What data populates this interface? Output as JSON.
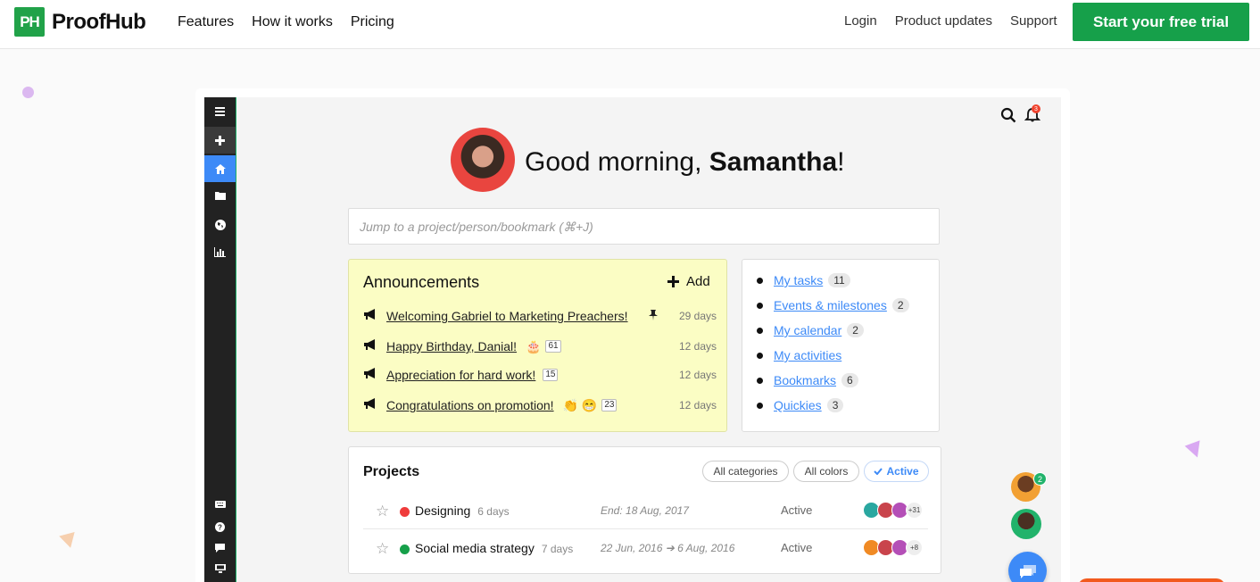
{
  "nav": {
    "logo_mark": "PH",
    "logo_text": "ProofHub",
    "links": [
      "Features",
      "How it works",
      "Pricing"
    ],
    "right_links": [
      "Login",
      "Product updates",
      "Support"
    ],
    "cta": "Start your free trial"
  },
  "app": {
    "notifications_count": "3",
    "greeting_prefix": "Good morning, ",
    "user_name": "Samantha",
    "greeting_suffix": "!",
    "search_placeholder": "Jump to a project/person/bookmark (⌘+J)",
    "announcements": {
      "title": "Announcements",
      "add_label": "Add",
      "items": [
        {
          "text": "Welcoming Gabriel to Marketing Preachers!",
          "days": "29 days",
          "pinned": true,
          "emoji": "",
          "count": ""
        },
        {
          "text": "Happy Birthday, Danial!",
          "days": "12 days",
          "pinned": false,
          "emoji": "🎂",
          "count": "61"
        },
        {
          "text": "Appreciation for hard work!",
          "days": "12 days",
          "pinned": false,
          "emoji": "",
          "count": "15"
        },
        {
          "text": "Congratulations on promotion!",
          "days": "12 days",
          "pinned": false,
          "emoji": "👏 😁",
          "count": "23"
        }
      ]
    },
    "quick_links": [
      {
        "label": "My tasks",
        "count": "11"
      },
      {
        "label": "Events & milestones",
        "count": "2"
      },
      {
        "label": "My calendar",
        "count": "2"
      },
      {
        "label": "My activities",
        "count": ""
      },
      {
        "label": "Bookmarks",
        "count": "6"
      },
      {
        "label": "Quickies",
        "count": "3"
      }
    ],
    "projects": {
      "title": "Projects",
      "filters": [
        "All categories",
        "All colors",
        "Active"
      ],
      "rows": [
        {
          "name": "Designing",
          "age": "6 days",
          "dates": "End: 18 Aug, 2017",
          "status": "Active",
          "color": "#ef3b3b",
          "more": "+31"
        },
        {
          "name": "Social media strategy",
          "age": "7 days",
          "dates": "22 Jun, 2016 ➔ 6 Aug, 2016",
          "status": "Active",
          "color": "#16a04a",
          "more": "+8"
        }
      ]
    },
    "online_badge": "2"
  },
  "colors": {
    "brand_green": "#16a04a",
    "accent_blue": "#3d8af7",
    "announcement_bg": "#fbfdc4"
  }
}
